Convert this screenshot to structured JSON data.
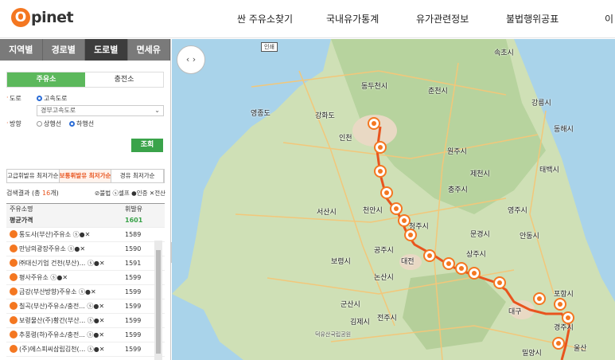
{
  "header": {
    "logo_o": "O",
    "logo_rest": "pinet",
    "nav": [
      "싼 주유소찾기",
      "국내유가통계",
      "유가관련정보",
      "불법행위공표",
      "이"
    ]
  },
  "panel": {
    "tabs": [
      "지역별",
      "경로별",
      "도로별",
      "면세유"
    ],
    "active_tab": 2,
    "type_tabs": [
      "주유소",
      "충전소"
    ],
    "road_label": "도로",
    "road_option": "고속도로",
    "road_select": "경부고속도로",
    "direction_label": "방향",
    "direction_up": "상행선",
    "direction_down": "하행선",
    "search_button": "조회",
    "sort_tabs": [
      "고급휘발유 최저가순",
      "보통휘발유 최저가순",
      "경유 최저가순"
    ],
    "result_prefix": "검색결과 (총 ",
    "result_count": "16",
    "result_suffix": "개)",
    "legend": "⊘불법 ⓢ셀프 ●인증 ✕전산",
    "columns": [
      "주유소명",
      "휘발유"
    ],
    "average_label": "평균가격",
    "average_price": "1601",
    "rows": [
      {
        "name": "통도사(부산)주유소 ⓢ●✕",
        "price": "1589"
      },
      {
        "name": "만남의광장주유소 ⓢ●✕",
        "price": "1590"
      },
      {
        "name": "㈜대신기업 건천(부산)... ⓢ●✕",
        "price": "1591"
      },
      {
        "name": "평사주유소 ⓢ●✕",
        "price": "1599"
      },
      {
        "name": "금강(부산방향)주유소 ⓢ●✕",
        "price": "1599"
      },
      {
        "name": "칠곡(부산)주유소/충전... ⓢ●✕",
        "price": "1599"
      },
      {
        "name": "보령물산(주)황간(부산... ⓢ●✕",
        "price": "1599"
      },
      {
        "name": "추풍령(하)주유소/충전... ⓢ●✕",
        "price": "1599"
      },
      {
        "name": "(주)에스피씨삼립김천(... ⓢ●✕",
        "price": "1599"
      }
    ]
  },
  "map": {
    "mini_button": "인쇄",
    "labels": [
      "동두천시",
      "춘천시",
      "속초시",
      "강릉시",
      "동해시",
      "인천",
      "강화도",
      "영종도",
      "원주시",
      "제천시",
      "충주시",
      "태백시",
      "영주시",
      "서산시",
      "천안시",
      "청주시",
      "문경시",
      "안동시",
      "보령시",
      "공주시",
      "대전",
      "상주시",
      "논산시",
      "군산시",
      "김제시",
      "전주시",
      "대구",
      "포항시",
      "경주시",
      "울산",
      "밀양시",
      "덕유산국립공원"
    ]
  }
}
